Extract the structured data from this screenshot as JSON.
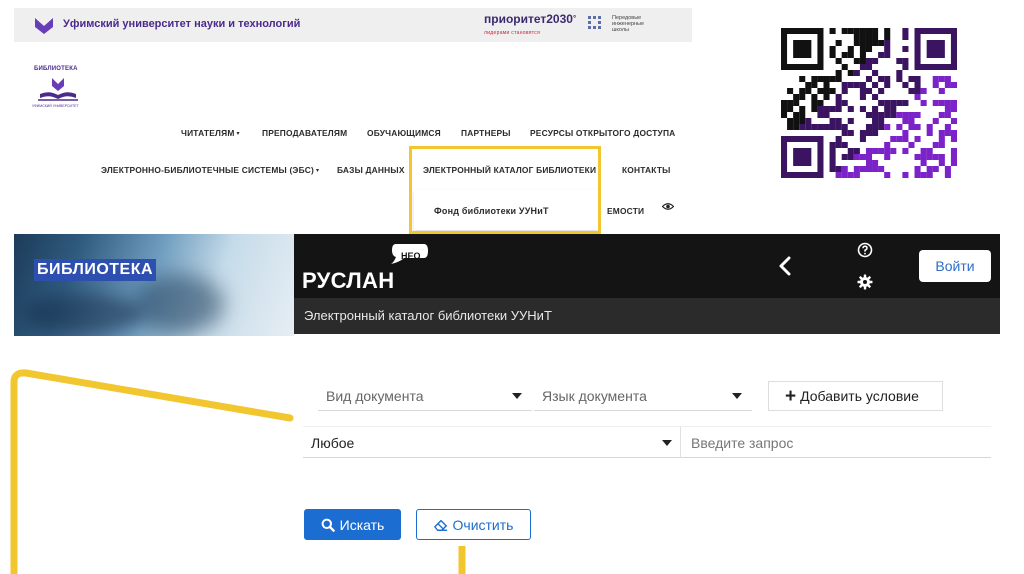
{
  "header": {
    "university_name": "Уфимский университет науки и технологий",
    "priority_brand": "приоритет2030",
    "priority_sup": "°",
    "priority_slogan": "лидерами становятся",
    "peis_line1": "Передовые",
    "peis_line2": "инженерные",
    "peis_line3": "школы"
  },
  "library_logo": {
    "caption": "БИБЛИОТЕКА",
    "subcaption": "УФИМСКИЙ УНИВЕРСИТЕТ"
  },
  "nav": {
    "row1": [
      "ЧИТАТЕЛЯМ",
      "ПРЕПОДАВАТЕЛЯМ",
      "ОБУЧАЮЩИМСЯ",
      "ПАРТНЕРЫ",
      "РЕСУРСЫ ОТКРЫТОГО ДОСТУПА"
    ],
    "row2": [
      "ЭЛЕКТРОННО-БИБЛИОТЕЧНЫЕ СИСТЕМЫ (ЭБС)",
      "БАЗЫ ДАННЫХ",
      "ЭЛЕКТРОННЫЙ КАТАЛОГ БИБЛИОТЕКИ",
      "КОНТАКТЫ"
    ],
    "row3_partial": "ЕМОСТИ",
    "dropdown_item": "Фонд библиотеки УУНиТ",
    "caret": "▾"
  },
  "banner": {
    "title": "БИБЛИОТЕКА"
  },
  "ruslan": {
    "logo_text": "РУСЛАН",
    "badge": "НЕО",
    "login_label": "Войти",
    "catalog_title": "Электронный каталог библиотеки УУНиТ"
  },
  "search_form": {
    "doc_type_placeholder": "Вид документа",
    "doc_lang_placeholder": "Язык документа",
    "add_condition_label": "Добавить условие",
    "field_select_value": "Любое",
    "query_placeholder": "Введите запрос",
    "search_label": "Искать",
    "clear_label": "Очистить"
  },
  "colors": {
    "highlight": "#f2c62e",
    "brand_purple": "#4b2a8c",
    "primary_blue": "#1b6dd1",
    "dark_bar": "#141414"
  }
}
